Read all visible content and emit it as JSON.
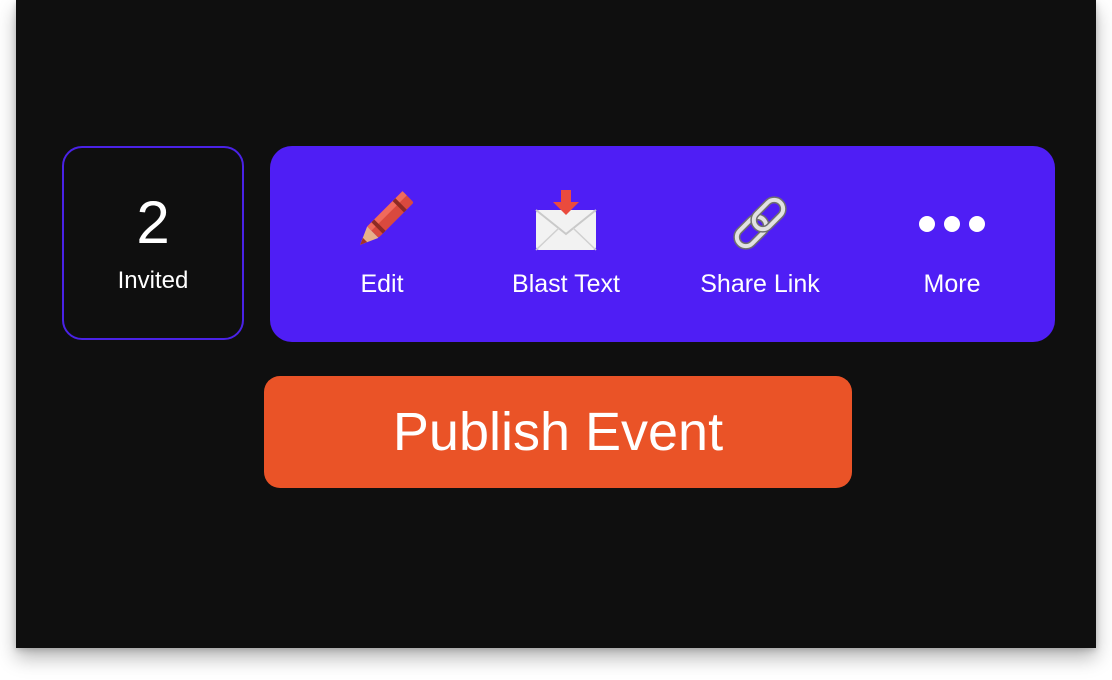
{
  "stats": {
    "invited_count": "2",
    "invited_label": "Invited"
  },
  "actions": [
    {
      "label": "Edit",
      "icon": "crayon-icon"
    },
    {
      "label": "Blast Text",
      "icon": "envelope-arrow-icon"
    },
    {
      "label": "Share Link",
      "icon": "link-icon"
    },
    {
      "label": "More",
      "icon": "more-dots-icon"
    }
  ],
  "publish": {
    "label": "Publish Event"
  },
  "colors": {
    "background": "#0f0f0f",
    "action_bar": "#4f1ef5",
    "invited_border": "#4a22e6",
    "publish_button": "#ea5327",
    "text": "#ffffff"
  }
}
